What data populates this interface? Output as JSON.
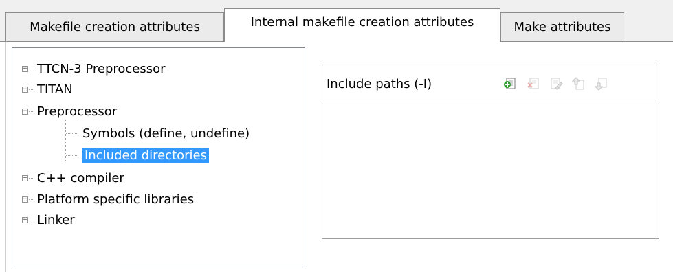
{
  "tabs": [
    {
      "label": "Makefile creation attributes",
      "active": false
    },
    {
      "label": "Internal makefile creation attributes",
      "active": true
    },
    {
      "label": "Make attributes",
      "active": false
    }
  ],
  "tree": {
    "items": [
      {
        "label": "TTCN-3 Preprocessor",
        "state": "collapsed"
      },
      {
        "label": "TITAN",
        "state": "collapsed"
      },
      {
        "label": "Preprocessor",
        "state": "expanded"
      },
      {
        "label": "Symbols (define, undefine)",
        "state": "leaf"
      },
      {
        "label": "Included directories",
        "state": "leaf",
        "selected": true
      },
      {
        "label": "C++ compiler",
        "state": "collapsed"
      },
      {
        "label": "Platform specific libraries",
        "state": "collapsed"
      },
      {
        "label": "Linker",
        "state": "collapsed"
      }
    ]
  },
  "include_panel": {
    "title": "Include paths (-I)",
    "tools": [
      "add-icon",
      "delete-icon",
      "edit-icon",
      "move-up-icon",
      "move-down-icon"
    ],
    "items": []
  },
  "colors": {
    "selection": "#3399ff",
    "add_icon": "#2e9e2e"
  }
}
